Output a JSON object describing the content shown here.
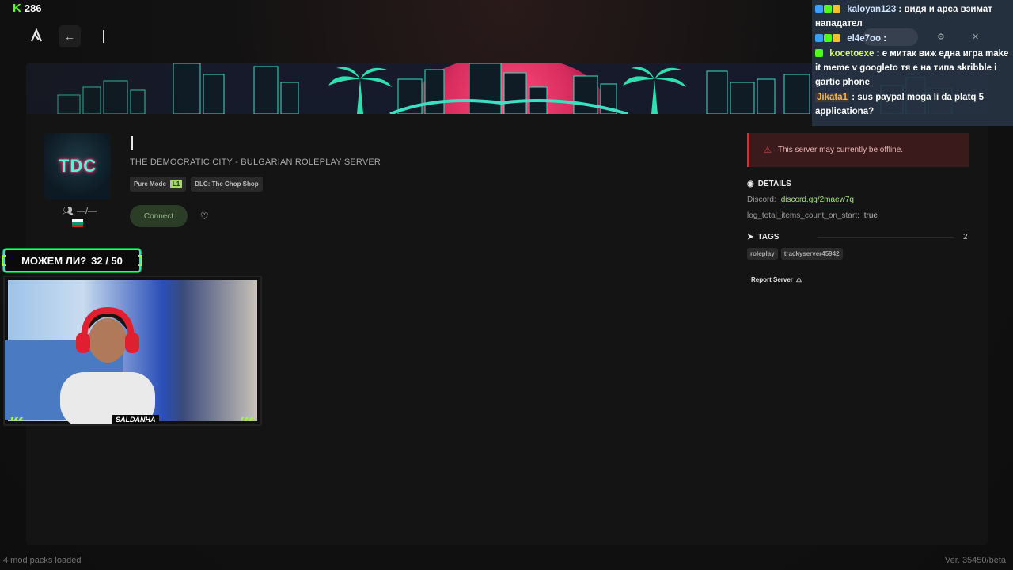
{
  "kick_counter": {
    "value": "286"
  },
  "nav": {
    "back_glyph": "←"
  },
  "server": {
    "logo_text": "TDC",
    "subtitle": "THE DEMOCRATIC CITY - BULGARIAN ROLEPLAY SERVER",
    "players": "—/—",
    "badges": [
      {
        "label": "Pure Mode",
        "level": "L1"
      },
      {
        "label": "DLC: The Chop Shop"
      }
    ],
    "connect_label": "Connect",
    "flag_colors": [
      "#ffffff",
      "#00966e",
      "#d62612"
    ]
  },
  "alert": {
    "text": "This server may currently be offline."
  },
  "details": {
    "heading": "DETAILS",
    "discord_label": "Discord:",
    "discord_value": "discord.gg/2maew7q",
    "log_label": "log_total_items_count_on_start:",
    "log_value": "true"
  },
  "tags": {
    "heading": "TAGS",
    "count": "2",
    "items": [
      "roleplay",
      "trackyserver45942"
    ]
  },
  "report_label": "Report Server",
  "footer": {
    "left": "4 mod packs loaded",
    "right": "Ver. 35450/beta"
  },
  "challenge": {
    "text": "МОЖЕМ ЛИ?",
    "score": "32 / 50"
  },
  "webcam": {
    "label": "SALDANHA"
  },
  "chat": {
    "messages": [
      {
        "user": "kaloyan123",
        "user_color": "#cfe3ff",
        "text": ": видя и арса взимат нападател"
      },
      {
        "user": "el4e7oo",
        "user_color": "#cfe3ff",
        "text": ":"
      },
      {
        "user": "kocetoexe",
        "user_color": "#d4ff5a",
        "text": ": е митак виж една игра make it meme v googleto тя е на типа skribble i gartic phone"
      },
      {
        "user": "Jikata1",
        "user_color": "#ffb24a",
        "text": ": sus paypal moga li da platq 5 applicationa?"
      }
    ]
  },
  "colors": {
    "accent_green": "#53fc18",
    "alert_red": "#c6363c",
    "link_green": "#a5e07a"
  }
}
